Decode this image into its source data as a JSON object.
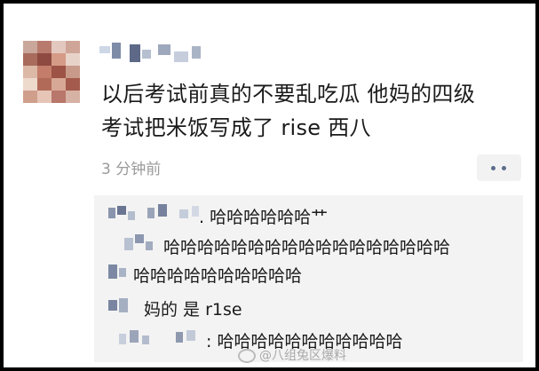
{
  "post": {
    "author": "",
    "text_line1": "以后考试前真的不要乱吃瓜 他妈的四级",
    "text_line2": "考试把米饭写成了 rise 西八",
    "timestamp": "3 分钟前",
    "more_icon": "ellipsis-icon"
  },
  "comments": [
    {
      "text": ". 哈哈哈哈哈哈艹"
    },
    {
      "text": "哈哈哈哈哈哈哈哈哈哈哈哈哈哈哈哈哈"
    },
    {
      "text": "哈哈哈哈哈哈哈哈哈哈"
    },
    {
      "text": "妈的 是 r1se"
    },
    {
      "text": ": 哈哈哈哈哈哈哈哈哈哈哈"
    }
  ],
  "watermark": {
    "text": "@八组兔区爆料",
    "icon": "weibo-logo-icon"
  },
  "colors": {
    "background": "#ffffff",
    "frame": "#000000",
    "comment_bg": "#f3f3f3",
    "timestamp": "#9a9a9a",
    "dots": "#5b6b8c"
  }
}
